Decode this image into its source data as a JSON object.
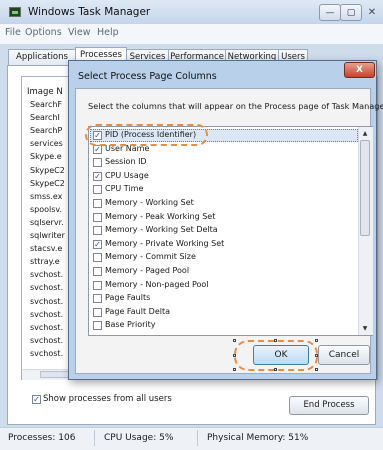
{
  "window": {
    "title": "Windows Task Manager",
    "min_symbol": "—",
    "max_symbol": "▢",
    "close_symbol": "✕"
  },
  "menu": [
    "File",
    "Options",
    "View",
    "Help"
  ],
  "tabs": [
    {
      "label": "Applications",
      "active": false
    },
    {
      "label": "Processes",
      "active": true
    },
    {
      "label": "Services",
      "active": false
    },
    {
      "label": "Performance",
      "active": false
    },
    {
      "label": "Networking",
      "active": false
    },
    {
      "label": "Users",
      "active": false
    }
  ],
  "process_list": {
    "header": "Image N",
    "rows": [
      "SearchF",
      "SearchI",
      "SearchP",
      "services",
      "Skype.e",
      "SkypeC2",
      "SkypeC2",
      "smss.ex",
      "spoolsv.",
      "sqlservr.",
      "sqlwriter",
      "stacsv.e",
      "sttray.e",
      "svchost.",
      "svchost.",
      "svchost.",
      "svchost.",
      "svchost.",
      "svchost.",
      "svchost."
    ]
  },
  "show_all_users": {
    "label": "Show processes from all users",
    "checked": true
  },
  "end_process_label": "End Process",
  "status_bar": {
    "processes": "Processes: 106",
    "cpu": "CPU Usage: 5%",
    "memory": "Physical Memory: 51%"
  },
  "dialog": {
    "title": "Select Process Page Columns",
    "close_symbol": "X",
    "instruction": "Select the columns that will appear on the Process page of Task Manager.",
    "columns": [
      {
        "label": "PID (Process Identifier)",
        "checked": true
      },
      {
        "label": "User Name",
        "checked": true
      },
      {
        "label": "Session ID",
        "checked": false
      },
      {
        "label": "CPU Usage",
        "checked": true
      },
      {
        "label": "CPU Time",
        "checked": false
      },
      {
        "label": "Memory - Working Set",
        "checked": false
      },
      {
        "label": "Memory - Peak Working Set",
        "checked": false
      },
      {
        "label": "Memory - Working Set Delta",
        "checked": false
      },
      {
        "label": "Memory - Private Working Set",
        "checked": true
      },
      {
        "label": "Memory - Commit Size",
        "checked": false
      },
      {
        "label": "Memory - Paged Pool",
        "checked": false
      },
      {
        "label": "Memory - Non-paged Pool",
        "checked": false
      },
      {
        "label": "Page Faults",
        "checked": false
      },
      {
        "label": "Page Fault Delta",
        "checked": false
      },
      {
        "label": "Base Priority",
        "checked": false
      }
    ],
    "ok_label": "OK",
    "cancel_label": "Cancel"
  },
  "check_glyph": "✓",
  "colors": {
    "highlight_ring": "#ef8b3d",
    "dialog_frame": "#b8d0ea"
  }
}
